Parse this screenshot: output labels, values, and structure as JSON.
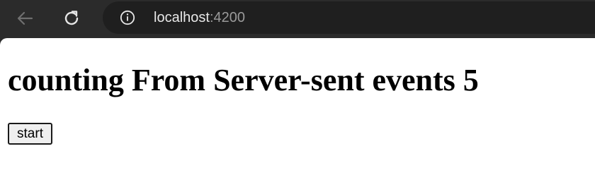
{
  "browser": {
    "url_host": "localhost",
    "url_port": ":4200",
    "icons": {
      "back": "back-arrow-icon",
      "reload": "reload-icon",
      "site_info": "info-icon"
    }
  },
  "page": {
    "title": "counting From Server-sent events 5",
    "start_button_label": "start"
  }
}
